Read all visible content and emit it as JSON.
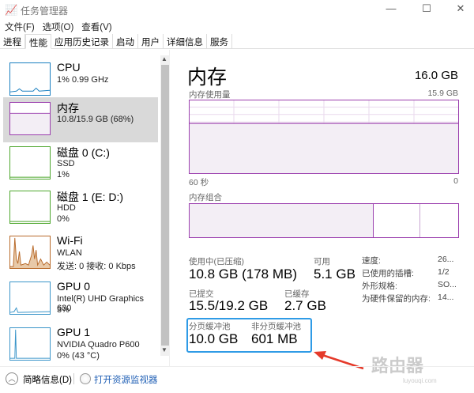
{
  "window": {
    "title": "任务管理器",
    "minimize": "—",
    "maximize": "☐",
    "close": "✕"
  },
  "menu": [
    "文件(F)",
    "选项(O)",
    "查看(V)"
  ],
  "tabs": [
    "进程",
    "性能",
    "应用历史记录",
    "启动",
    "用户",
    "详细信息",
    "服务"
  ],
  "sidebar": [
    {
      "name": "CPU",
      "sub1": "1% 0.99 GHz",
      "sub2": "",
      "color": "#1a7fc0"
    },
    {
      "name": "内存",
      "sub1": "10.8/15.9 GB (68%)",
      "sub2": "",
      "color": "#9b3fae"
    },
    {
      "name": "磁盘 0 (C:)",
      "sub1": "SSD",
      "sub2": "1%",
      "color": "#4ea72e"
    },
    {
      "name": "磁盘 1 (E: D:)",
      "sub1": "HDD",
      "sub2": "0%",
      "color": "#4ea72e"
    },
    {
      "name": "Wi-Fi",
      "sub1": "WLAN",
      "sub2": "发送: 0 接收: 0 Kbps",
      "color": "#b86a2a"
    },
    {
      "name": "GPU 0",
      "sub1": "Intel(R) UHD Graphics 630",
      "sub2": "3%",
      "color": "#3a95c9"
    },
    {
      "name": "GPU 1",
      "sub1": "NVIDIA Quadro P600",
      "sub2": "0% (43 °C)",
      "color": "#3a95c9"
    }
  ],
  "main": {
    "title": "内存",
    "total": "16.0 GB",
    "usage_label": "内存使用量",
    "usage_max": "15.9 GB",
    "axis_left": "60 秒",
    "axis_right": "0",
    "composition_label": "内存组合",
    "usage_percent": 68,
    "stats": {
      "in_use_label": "使用中(已压缩)",
      "in_use": "10.8 GB (178 MB)",
      "available_label": "可用",
      "available": "5.1 GB",
      "committed_label": "已提交",
      "committed": "15.5/19.2 GB",
      "cached_label": "已缓存",
      "cached": "2.7 GB",
      "paged_label": "分页缓冲池",
      "paged": "10.0 GB",
      "nonpaged_label": "非分页缓冲池",
      "nonpaged": "601 MB"
    },
    "props": [
      [
        "速度:",
        "26..."
      ],
      [
        "已使用的插槽:",
        "1/2"
      ],
      [
        "外形规格:",
        "SO..."
      ],
      [
        "为硬件保留的内存:",
        "14..."
      ]
    ]
  },
  "footer": {
    "fewer_details": "简略信息(D)",
    "resource_monitor": "打开资源监视器"
  },
  "watermark": {
    "text": "路由器",
    "sub": "luyouqi.com"
  }
}
